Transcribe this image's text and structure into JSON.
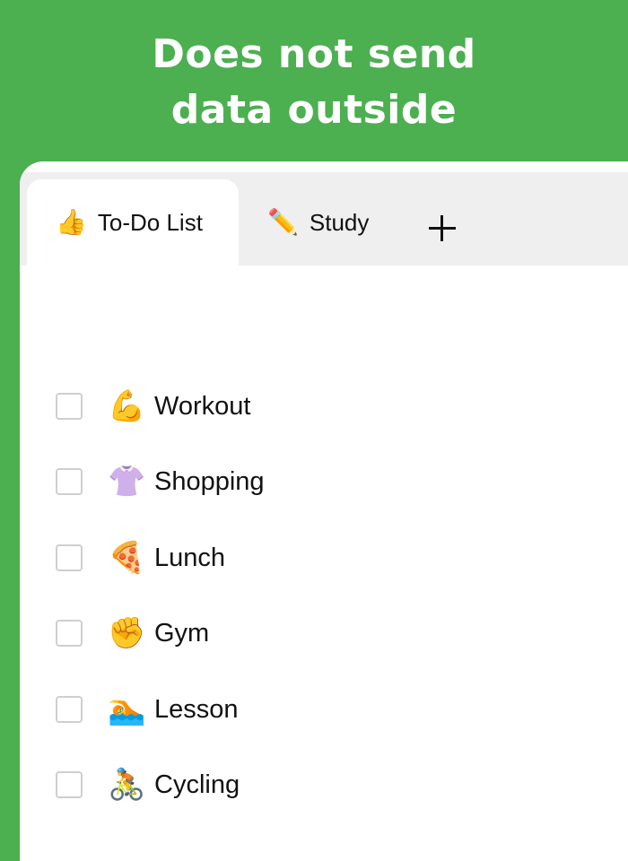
{
  "banner": {
    "line1": "Does not send",
    "line2": "data outside"
  },
  "tabs": [
    {
      "icon": "👍",
      "icon_name": "thumbs-up-icon",
      "label": "To-Do List",
      "active": true
    },
    {
      "icon": "✏️",
      "icon_name": "pencil-icon",
      "label": "Study",
      "active": false
    }
  ],
  "add_tab": {
    "icon_name": "plus-icon"
  },
  "items": [
    {
      "icon": "💪",
      "icon_name": "flexed-biceps-icon",
      "label": "Workout",
      "checked": false
    },
    {
      "icon": "👚",
      "icon_name": "blouse-icon",
      "label": "Shopping",
      "checked": false
    },
    {
      "icon": "🍕",
      "icon_name": "pizza-icon",
      "label": "Lunch",
      "checked": false
    },
    {
      "icon": "✊",
      "icon_name": "raised-fist-icon",
      "label": "Gym",
      "checked": false
    },
    {
      "icon": "🏊",
      "icon_name": "swimmer-icon",
      "label": "Lesson",
      "checked": false
    },
    {
      "icon": "🚴",
      "icon_name": "cyclist-icon",
      "label": "Cycling",
      "checked": false
    }
  ],
  "colors": {
    "background": "#4CAF50",
    "tabbar": "#EFEFEF",
    "checkbox_border": "#CFCFCF",
    "text": "#111111"
  }
}
